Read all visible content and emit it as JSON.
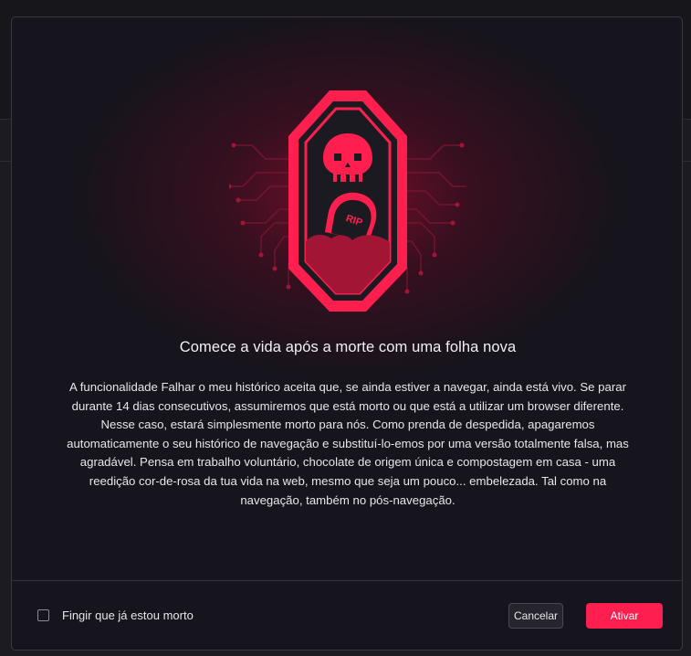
{
  "dialog": {
    "title": "Comece a vida após a morte com uma folha nova",
    "body": "A funcionalidade Falhar o meu histórico aceita que, se ainda estiver a navegar, ainda está vivo. Se parar durante 14 dias consecutivos, assumiremos que está morto ou que está a utilizar um browser diferente. Nesse caso, estará simplesmente morto para nós. Como prenda de despedida, apagaremos automaticamente o seu histórico de navegação e substituí-lo-emos por uma versão totalmente falsa, mas agradável. Pensa em trabalho voluntário, chocolate de origem única e compostagem em casa - uma reedição cor-de-rosa da tua vida na web, mesmo que seja um pouco... embelezada. Tal como na navegação, também no pós-navegação.",
    "illustration": {
      "badge_text": "RIP",
      "icons": [
        "skull-icon",
        "tombstone-icon",
        "circuit-lines"
      ]
    },
    "checkbox": {
      "label": "Fingir que já estou morto",
      "checked": false
    },
    "buttons": {
      "cancel": "Cancelar",
      "activate": "Ativar"
    }
  },
  "colors": {
    "accent": "#ff1f4f",
    "accent_dark": "#a31535",
    "dialog_bg": "#16141c",
    "text": "#e7e6ec"
  }
}
